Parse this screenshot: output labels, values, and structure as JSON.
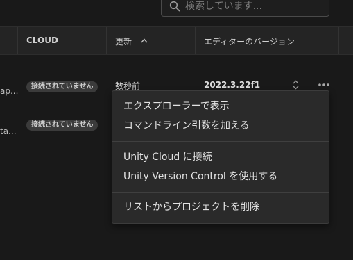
{
  "search": {
    "placeholder": "検索しています..."
  },
  "table": {
    "headers": {
      "cloud": "CLOUD",
      "updated": "更新",
      "editor_version": "エディターのバージョン"
    },
    "rows": [
      {
        "name_fragment": "ap...",
        "cloud_status": "接続されていません",
        "updated": "数秒前",
        "version": "2022.3.22f1"
      },
      {
        "name_fragment": "ta...",
        "cloud_status": "接続されていません"
      }
    ]
  },
  "context_menu": {
    "items": [
      "エクスプローラーで表示",
      "コマンドライン引数を加える",
      "Unity Cloud に接続",
      "Unity Version Control を使用する",
      "リストからプロジェクトを削除"
    ]
  },
  "icons": {
    "search": "search-icon",
    "sort": "chevron-up-icon",
    "version_select": "up-down-chevron-icon",
    "more": "more-horizontal-icon"
  },
  "colors": {
    "background": "#191919",
    "header_background": "#242424",
    "menu_background": "#2a2a2a",
    "badge_background": "#3b3b3b"
  }
}
